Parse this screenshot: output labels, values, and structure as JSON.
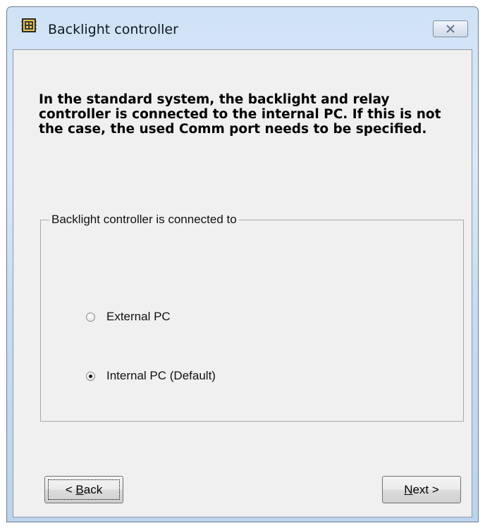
{
  "window": {
    "title": "Backlight controller",
    "close_symbol": "☒"
  },
  "intro": {
    "text": "In the standard system, the backlight and relay controller is connected to the internal PC. If this is not the case, the used Comm port needs to be specified."
  },
  "group": {
    "label": "Backlight controller is connected to",
    "options": [
      {
        "label": "External PC",
        "selected": false
      },
      {
        "label": "Internal PC  (Default)",
        "selected": true
      }
    ]
  },
  "buttons": {
    "back": {
      "prefix": "< ",
      "mnemonic": "B",
      "rest": "ack"
    },
    "next": {
      "mnemonic": "N",
      "rest": "ext >"
    }
  },
  "icons": {
    "app": "circuit-board-icon",
    "close": "close-icon"
  },
  "colors": {
    "title_gradient_top": "#cfe2f5",
    "client_background": "#f0f0f0",
    "app_icon_accent": "#e8c54a"
  }
}
